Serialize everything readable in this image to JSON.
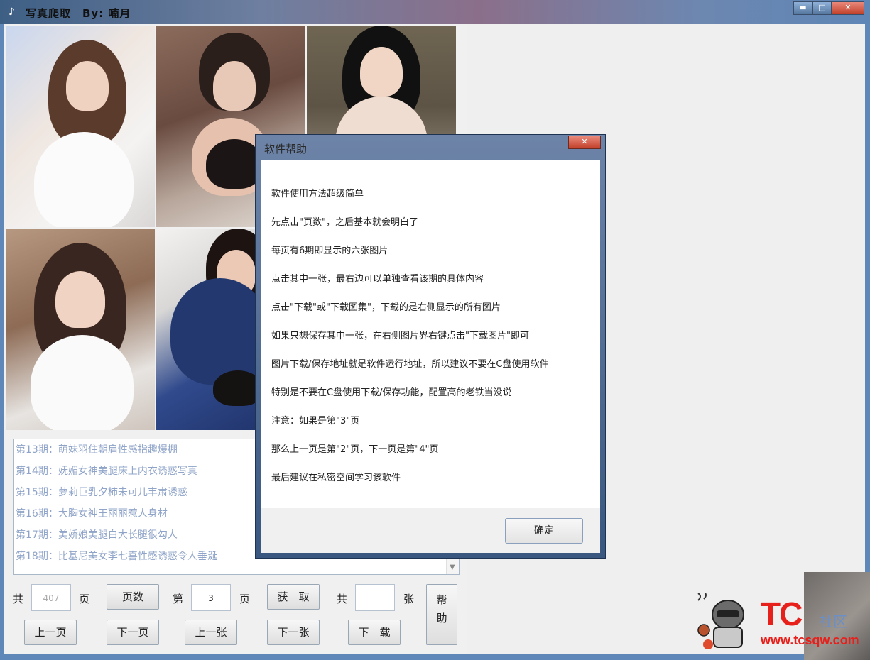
{
  "window": {
    "title": "写真爬取　By: 喃月",
    "minimize_label": "▬",
    "maximize_label": "□",
    "close_label": "✕"
  },
  "photos": [
    {
      "name": "photo-1"
    },
    {
      "name": "photo-2"
    },
    {
      "name": "photo-3"
    },
    {
      "name": "photo-4"
    },
    {
      "name": "photo-5"
    }
  ],
  "issue_list": [
    "第13期：萌妹羽住朝肩性感指趣爆棚",
    "第14期：妩媚女神美腿床上内衣诱惑写真",
    "第15期：萝莉巨乳夕柿未可儿丰肃诱惑",
    "第16期：大胸女神王丽丽惹人身材",
    "第17期：美娇娘美腿白大长腿很勾人",
    "第18期：比基尼美女李七喜性感诱惑令人垂涎"
  ],
  "controls": {
    "total_prefix": "共",
    "total_pages_value": "407",
    "page_unit": "页",
    "pages_button": "页数",
    "page_prefix": "第",
    "current_page_value": "3",
    "page_unit2": "页",
    "fetch_button": "获　取",
    "count_prefix": "共",
    "count_value": "",
    "count_unit": "张",
    "help_button_top": "帮",
    "help_button_bottom": "助",
    "prev_page_button": "上一页",
    "next_page_button": "下一页",
    "prev_image_button": "上一张",
    "next_image_button": "下一张",
    "download_button": "下　载"
  },
  "help_dialog": {
    "title": "软件帮助",
    "close_label": "✕",
    "lines": [
      "软件使用方法超级简单",
      "先点击\"页数\"，之后基本就会明白了",
      "每页有6期即显示的六张图片",
      "点击其中一张，最右边可以单独查看该期的具体内容",
      "点击\"下载\"或\"下载图集\"，下载的是右侧显示的所有图片",
      "如果只想保存其中一张，在右侧图片界右键点击\"下载图片\"即可",
      "图片下载/保存地址就是软件运行地址，所以建议不要在C盘使用软件",
      "特别是不要在C盘使用下载/保存功能，配置高的老铁当没说",
      "注意：如果是第\"3\"页",
      "那么上一页是第\"2\"页，下一页是第\"4\"页",
      "最后建议在私密空间学习该软件"
    ],
    "ok_button": "确定"
  },
  "watermark": {
    "brand": "TC",
    "sub": "社区",
    "url": "www.tcsqw.com"
  },
  "colors": {
    "titlebar_accent": "#5e86b6",
    "close_red": "#c1412b",
    "list_text": "#8fa4c8",
    "brand_red": "#e8201c"
  }
}
